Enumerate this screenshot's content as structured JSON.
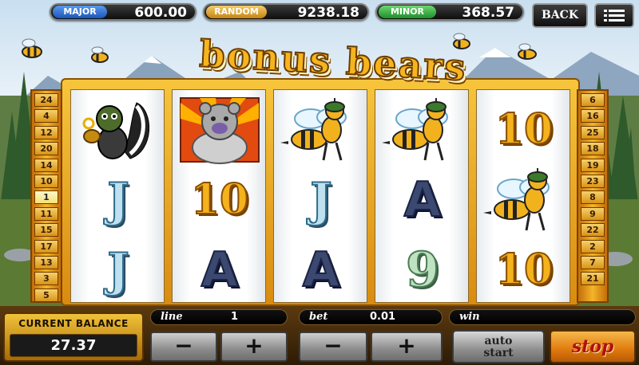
{
  "jackpots": {
    "major": {
      "label": "MAJOR",
      "value": "600.00",
      "color": "#2c6fd6"
    },
    "random": {
      "label": "RANDOM",
      "value": "9238.18",
      "color": "#e0a22a"
    },
    "minor": {
      "label": "MINOR",
      "value": "368.57",
      "color": "#2aa836"
    }
  },
  "nav": {
    "back_label": "BACK",
    "menu_icon": "menu-icon"
  },
  "title": "bonus bears",
  "paylines": {
    "left": [
      "24",
      "4",
      "12",
      "20",
      "14",
      "10",
      "1",
      "11",
      "15",
      "17",
      "13",
      "3",
      "5"
    ],
    "right": [
      "6",
      "16",
      "25",
      "18",
      "19",
      "23",
      "8",
      "9",
      "22",
      "2",
      "7",
      "21"
    ],
    "active_left": "1"
  },
  "reels": [
    [
      "skunk",
      "J",
      "J"
    ],
    [
      "bear",
      "10",
      "A"
    ],
    [
      "bee",
      "J",
      "A"
    ],
    [
      "bee",
      "A",
      "9"
    ],
    [
      "10",
      "bee",
      "10"
    ]
  ],
  "bottom": {
    "line_label": "line",
    "line_value": "1",
    "bet_label": "bet",
    "bet_value": "0.01",
    "win_label": "win",
    "win_value": "",
    "balance_title": "CURRENT BALANCE",
    "balance_value": "27.37",
    "minus": "−",
    "plus": "+",
    "auto_line1": "auto",
    "auto_line2": "start",
    "stop_label": "stop"
  },
  "colors": {
    "frame": "#f2b21e",
    "panel": "#3d2508",
    "stop": "#e07a0e"
  }
}
